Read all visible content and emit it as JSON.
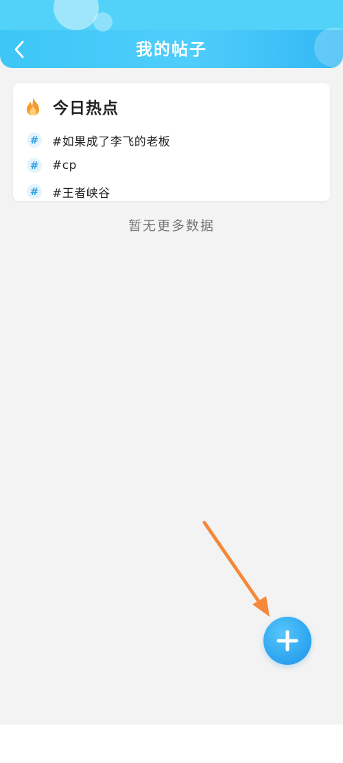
{
  "header": {
    "title": "我的帖子",
    "back_icon": "chevron-left-icon"
  },
  "hot_card": {
    "icon": "flame-icon",
    "title": "今日热点",
    "topics": [
      {
        "icon": "hash-icon",
        "label": "#如果成了李飞的老板"
      },
      {
        "icon": "hash-icon",
        "label": "#cp"
      },
      {
        "icon": "hash-icon",
        "label": "#王者峡谷"
      }
    ],
    "hash_symbol": "#"
  },
  "empty_state": {
    "text": "暂无更多数据"
  },
  "fab": {
    "icon": "plus-icon"
  },
  "colors": {
    "header_gradient": [
      "#3cc6f6",
      "#33b8f4"
    ],
    "accent": "#2ba2ef",
    "arrow": "#f5883b",
    "flame": "#f59a2e"
  }
}
